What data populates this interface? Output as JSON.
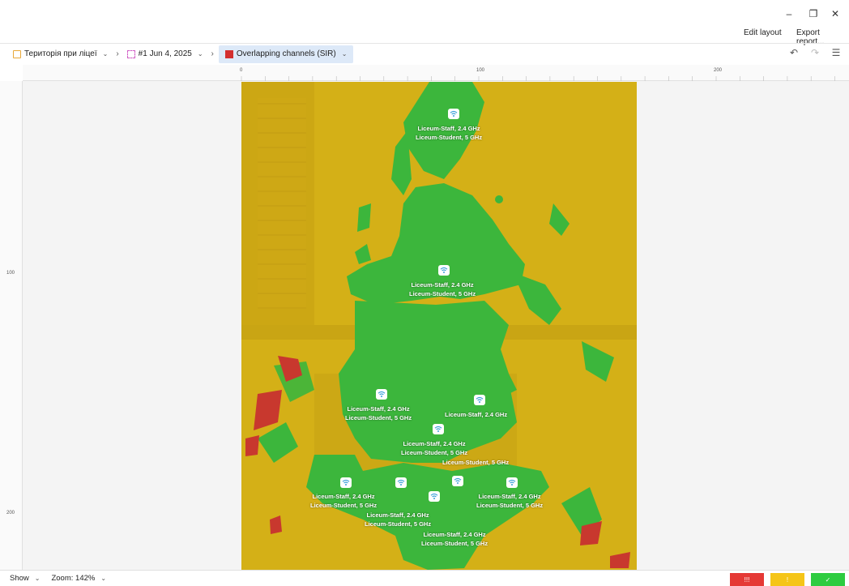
{
  "window": {
    "minimize_glyph": "–",
    "restore_glyph": "❐",
    "close_glyph": "✕"
  },
  "toolbar": {
    "edit_layout": "Edit layout",
    "export_report": "Export report..."
  },
  "breadcrumb": {
    "site": "Територія при ліцеї",
    "survey": "#1 Jun 4, 2025",
    "visualization": "Overlapping channels (SIR)",
    "site_icon_color": "#e8a838",
    "survey_icon_color": "#d05cc4",
    "visualization_color": "#d32f2f"
  },
  "rulers": {
    "h_ticks": [
      "0",
      "100",
      "200"
    ],
    "v_ticks": [
      "100",
      "200"
    ]
  },
  "colors": {
    "sir_good": "#3cb63c",
    "sir_medium": "#d4b017",
    "sir_poor": "#c8382e"
  },
  "access_points": [
    {
      "lines": [
        "Liceum-Staff, 2.4 GHz",
        "Liceum-Student, 5 GHz"
      ]
    },
    {
      "lines": [
        "Liceum-Staff, 2.4 GHz",
        "Liceum-Student, 5 GHz"
      ]
    },
    {
      "lines": [
        "Liceum-Staff, 2.4 GHz",
        "Liceum-Student, 5 GHz"
      ]
    },
    {
      "lines": [
        "Liceum-Staff, 2.4 GHz"
      ]
    },
    {
      "lines": [
        "Liceum-Staff, 2.4 GHz",
        "Liceum-Student, 5 GHz"
      ]
    },
    {
      "lines": [
        "Liceum-Student, 5 GHz"
      ]
    },
    {
      "lines": [
        "Liceum-Staff, 2.4 GHz",
        "Liceum-Student, 5 GHz"
      ]
    },
    {
      "lines": [
        "Liceum-Staff, 2.4 GHz",
        "Liceum-Student, 5 GHz"
      ]
    },
    {
      "lines": [
        "Liceum-Staff, 2.4 GHz",
        "Liceum-Student, 5 GHz"
      ]
    },
    {
      "lines": [
        "Liceum-Staff, 2.4 GHz",
        "Liceum-Student, 5 GHz"
      ]
    },
    {
      "lines": [
        "Liceum-Staff, 2.4 GHz",
        "Liceum-Student, 5 GHz"
      ]
    }
  ],
  "bottom": {
    "show_label": "Show",
    "zoom_label": "Zoom: 142%",
    "badges": [
      {
        "text": "!!!",
        "color": "#e53935"
      },
      {
        "text": "!",
        "color": "#f5c518"
      },
      {
        "text": "✓",
        "color": "#2ecc40"
      }
    ]
  }
}
